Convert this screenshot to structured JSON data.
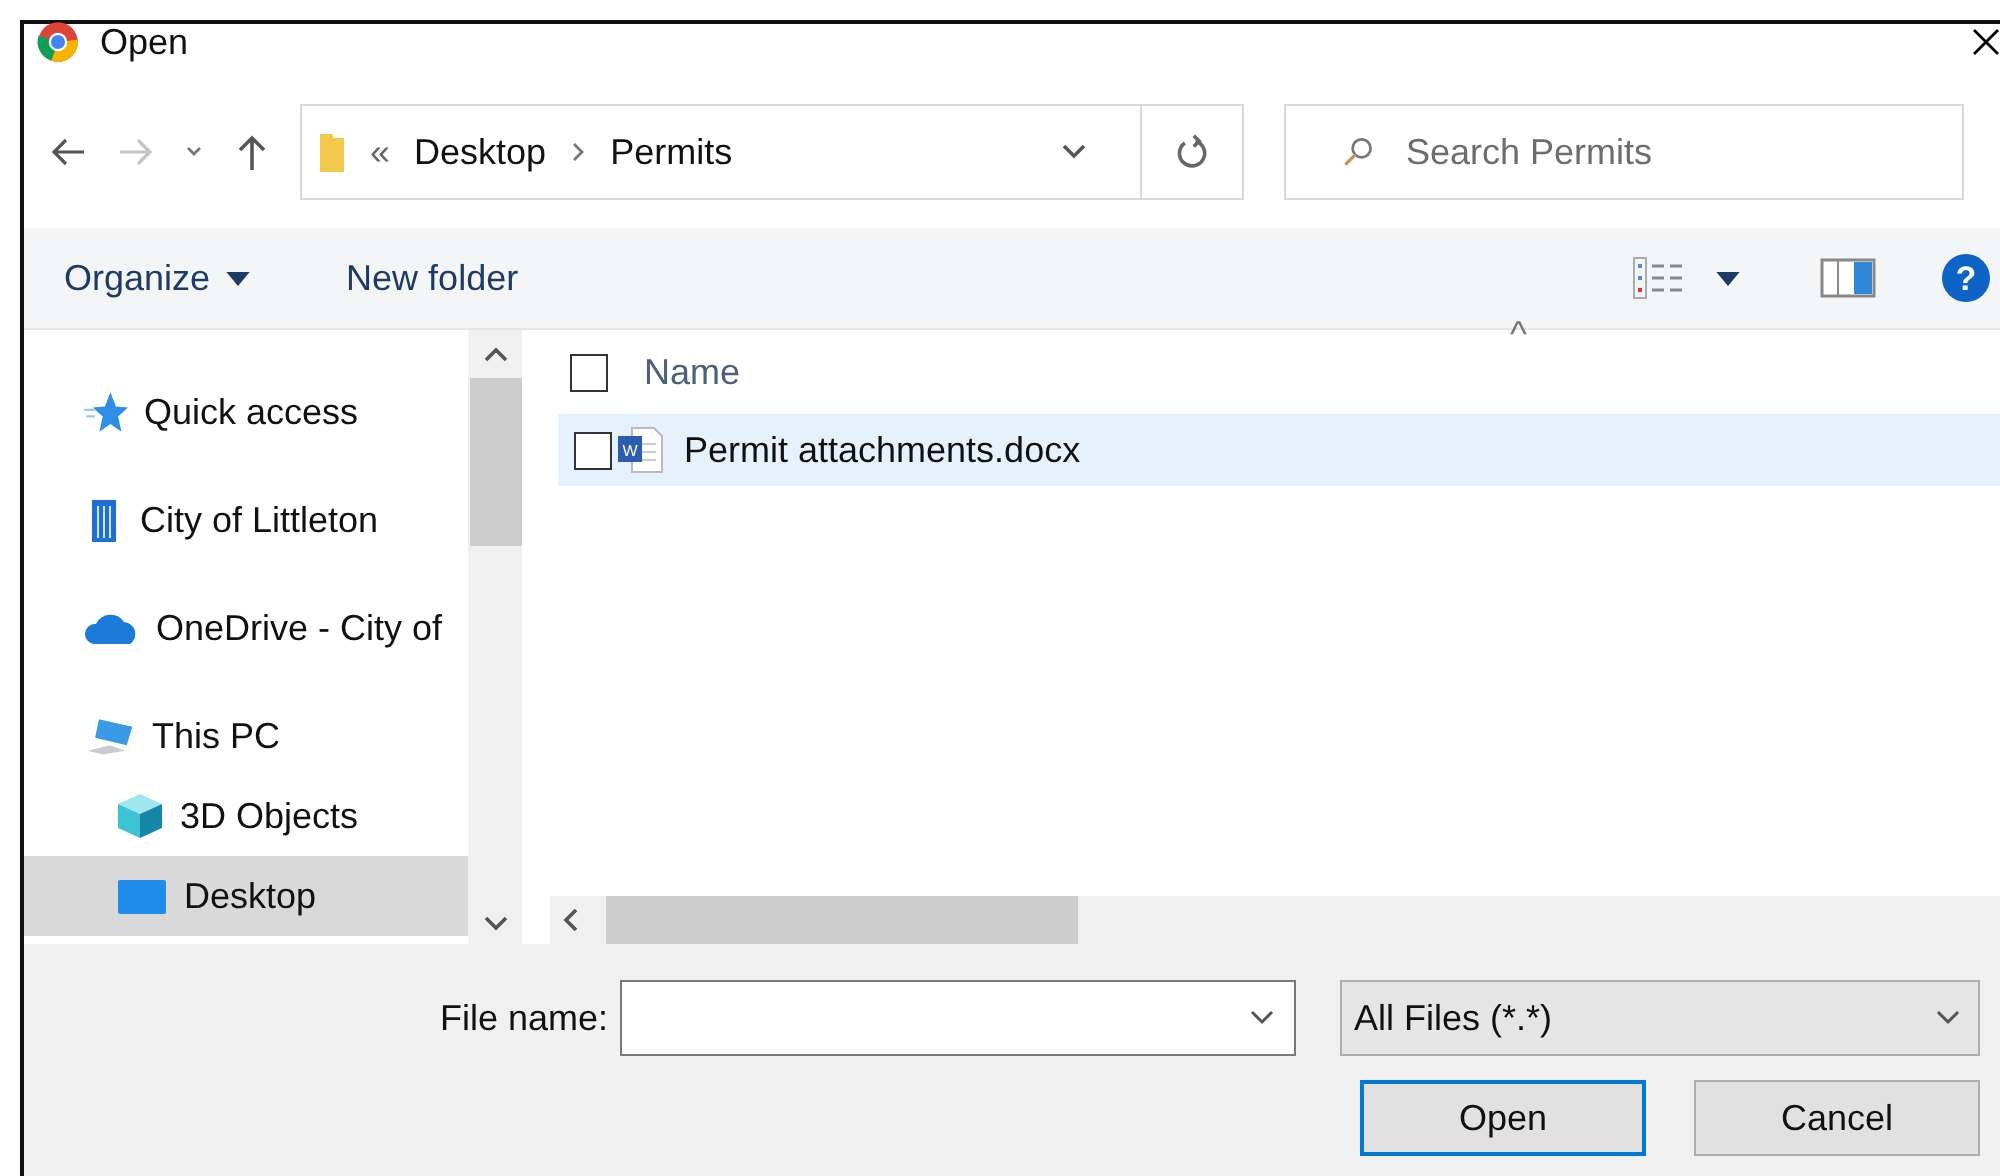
{
  "window": {
    "title": "Open"
  },
  "address": {
    "overflow": "«",
    "path": [
      "Desktop",
      "Permits"
    ]
  },
  "search": {
    "placeholder": "Search Permits"
  },
  "toolbar": {
    "organize": "Organize",
    "new_folder": "New folder"
  },
  "sidebar": {
    "items": [
      {
        "label": "Quick access",
        "kind": "star",
        "selected": false
      },
      {
        "label": "City of Littleton",
        "kind": "building",
        "selected": false
      },
      {
        "label": "OneDrive - City of",
        "kind": "cloud",
        "selected": false
      },
      {
        "label": "This PC",
        "kind": "pc",
        "selected": false,
        "children": [
          {
            "label": "3D Objects",
            "kind": "cube",
            "selected": false
          },
          {
            "label": "Desktop",
            "kind": "desktop",
            "selected": true
          }
        ]
      }
    ]
  },
  "help_icon": "?",
  "file_list": {
    "column": "Name",
    "select_all_checked": false,
    "sort_indicator": "^",
    "files": [
      {
        "name": "Permit attachments.docx",
        "icon_letter": "W",
        "selected": true,
        "checked": false
      }
    ]
  },
  "file_name": {
    "label": "File name:"
  },
  "file_type": {
    "value": "All Files (*.*)"
  },
  "buttons": [
    {
      "label": "Open",
      "kind": "default"
    },
    {
      "label": "Cancel",
      "kind": "normal"
    }
  ]
}
